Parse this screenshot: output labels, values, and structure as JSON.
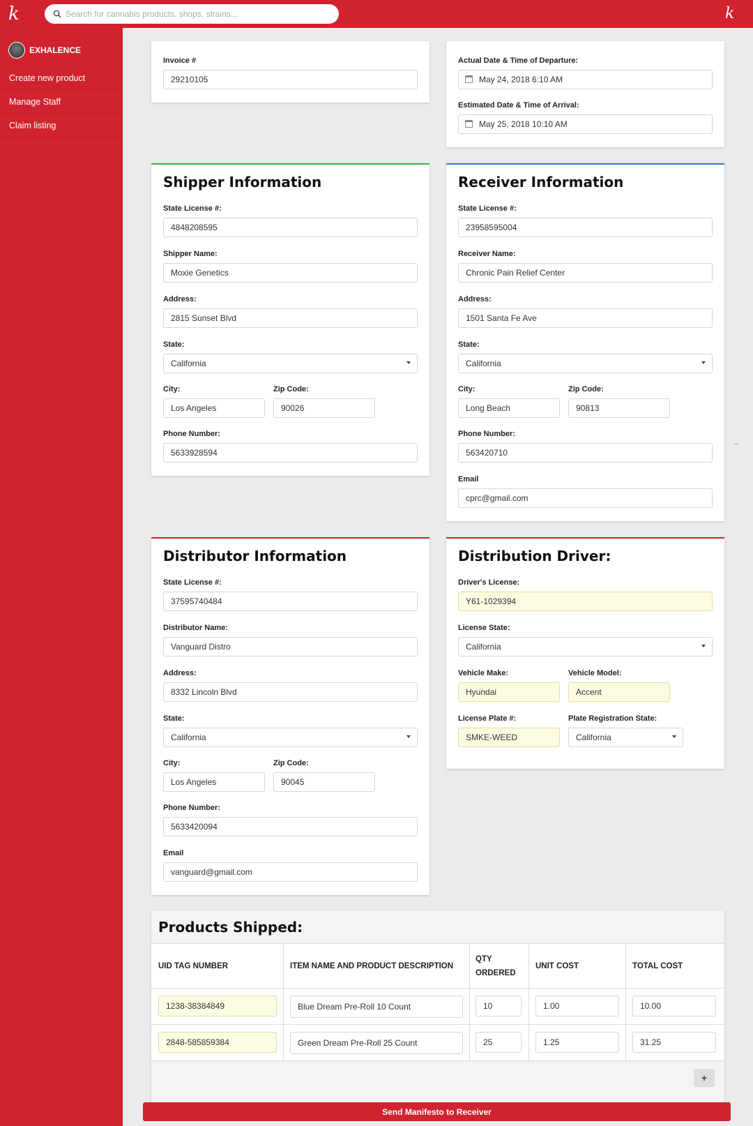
{
  "topbar": {
    "logo": "k",
    "search_placeholder": "Search for cannabis products, shops, strains..."
  },
  "sidebar": {
    "brand": "EXHALENCE",
    "items": [
      "Create new product",
      "Manage Staff",
      "Claim listing"
    ]
  },
  "invoice": {
    "label": "Invoice #",
    "value": "29210105"
  },
  "dates": {
    "departure_label": "Actual Date & Time of Departure:",
    "departure_value": "May 24, 2018 6:10 AM",
    "arrival_label": "Estimated Date & Time of Arrival:",
    "arrival_value": "May 25, 2018 10:10 AM"
  },
  "shipper": {
    "title": "Shipper Information",
    "license_label": "State License #:",
    "license": "4848208595",
    "name_label": "Shipper Name:",
    "name": "Moxie Genetics",
    "address_label": "Address:",
    "address": "2815 Sunset Blvd",
    "state_label": "State:",
    "state": "California",
    "city_label": "City:",
    "city": "Los Angeles",
    "zip_label": "Zip Code:",
    "zip": "90026",
    "phone_label": "Phone Number:",
    "phone": "5633928594"
  },
  "receiver": {
    "title": "Receiver Information",
    "license_label": "State License #:",
    "license": "23958595004",
    "name_label": "Receiver Name:",
    "name": "Chronic Pain Relief Center",
    "address_label": "Address:",
    "address": "1501 Santa Fe Ave",
    "state_label": "State:",
    "state": "California",
    "city_label": "City:",
    "city": "Long Beach",
    "zip_label": "Zip Code:",
    "zip": "90813",
    "phone_label": "Phone Number:",
    "phone": "563420710",
    "email_label": "Email",
    "email": "cprc@gmail.com"
  },
  "distributor": {
    "title": "Distributor Information",
    "license_label": "State License #:",
    "license": "37595740484",
    "name_label": "Distributor Name:",
    "name": "Vanguard Distro",
    "address_label": "Address:",
    "address": "8332 Lincoln Blvd",
    "state_label": "State:",
    "state": "California",
    "city_label": "City:",
    "city": "Los Angeles",
    "zip_label": "Zip Code:",
    "zip": "90045",
    "phone_label": "Phone Number:",
    "phone": "5633420094",
    "email_label": "Email",
    "email": "vanguard@gmail.com"
  },
  "driver": {
    "title": "Distribution Driver:",
    "license_label": "Driver's License:",
    "license": "Y61-1029394",
    "license_state_label": "License State:",
    "license_state": "California",
    "make_label": "Vehicle Make:",
    "make": "Hyundai",
    "model_label": "Vehicle Model:",
    "model": "Accent",
    "plate_label": "License Plate #:",
    "plate": "SMKE-WEED",
    "plate_state_label": "Plate Registration State:",
    "plate_state": "California"
  },
  "products": {
    "title": "Products Shipped:",
    "headers": {
      "uid": "UID TAG NUMBER",
      "item": "ITEM NAME AND PRODUCT DESCRIPTION",
      "qty_line1": "QTY",
      "qty_line2": "ORDERED",
      "unit": "UNIT COST",
      "total": "TOTAL COST"
    },
    "rows": [
      {
        "uid": "1238-38384849",
        "item": "Blue Dream Pre-Roll 10 Count",
        "qty": "10",
        "unit": "1.00",
        "total": "10.00"
      },
      {
        "uid": "2848-585859384",
        "item": "Green Dream Pre-Roll 25 Count",
        "qty": "25",
        "unit": "1.25",
        "total": "31.25"
      }
    ],
    "add_label": "+"
  },
  "send_button": "Send Manifesto to Receiver"
}
